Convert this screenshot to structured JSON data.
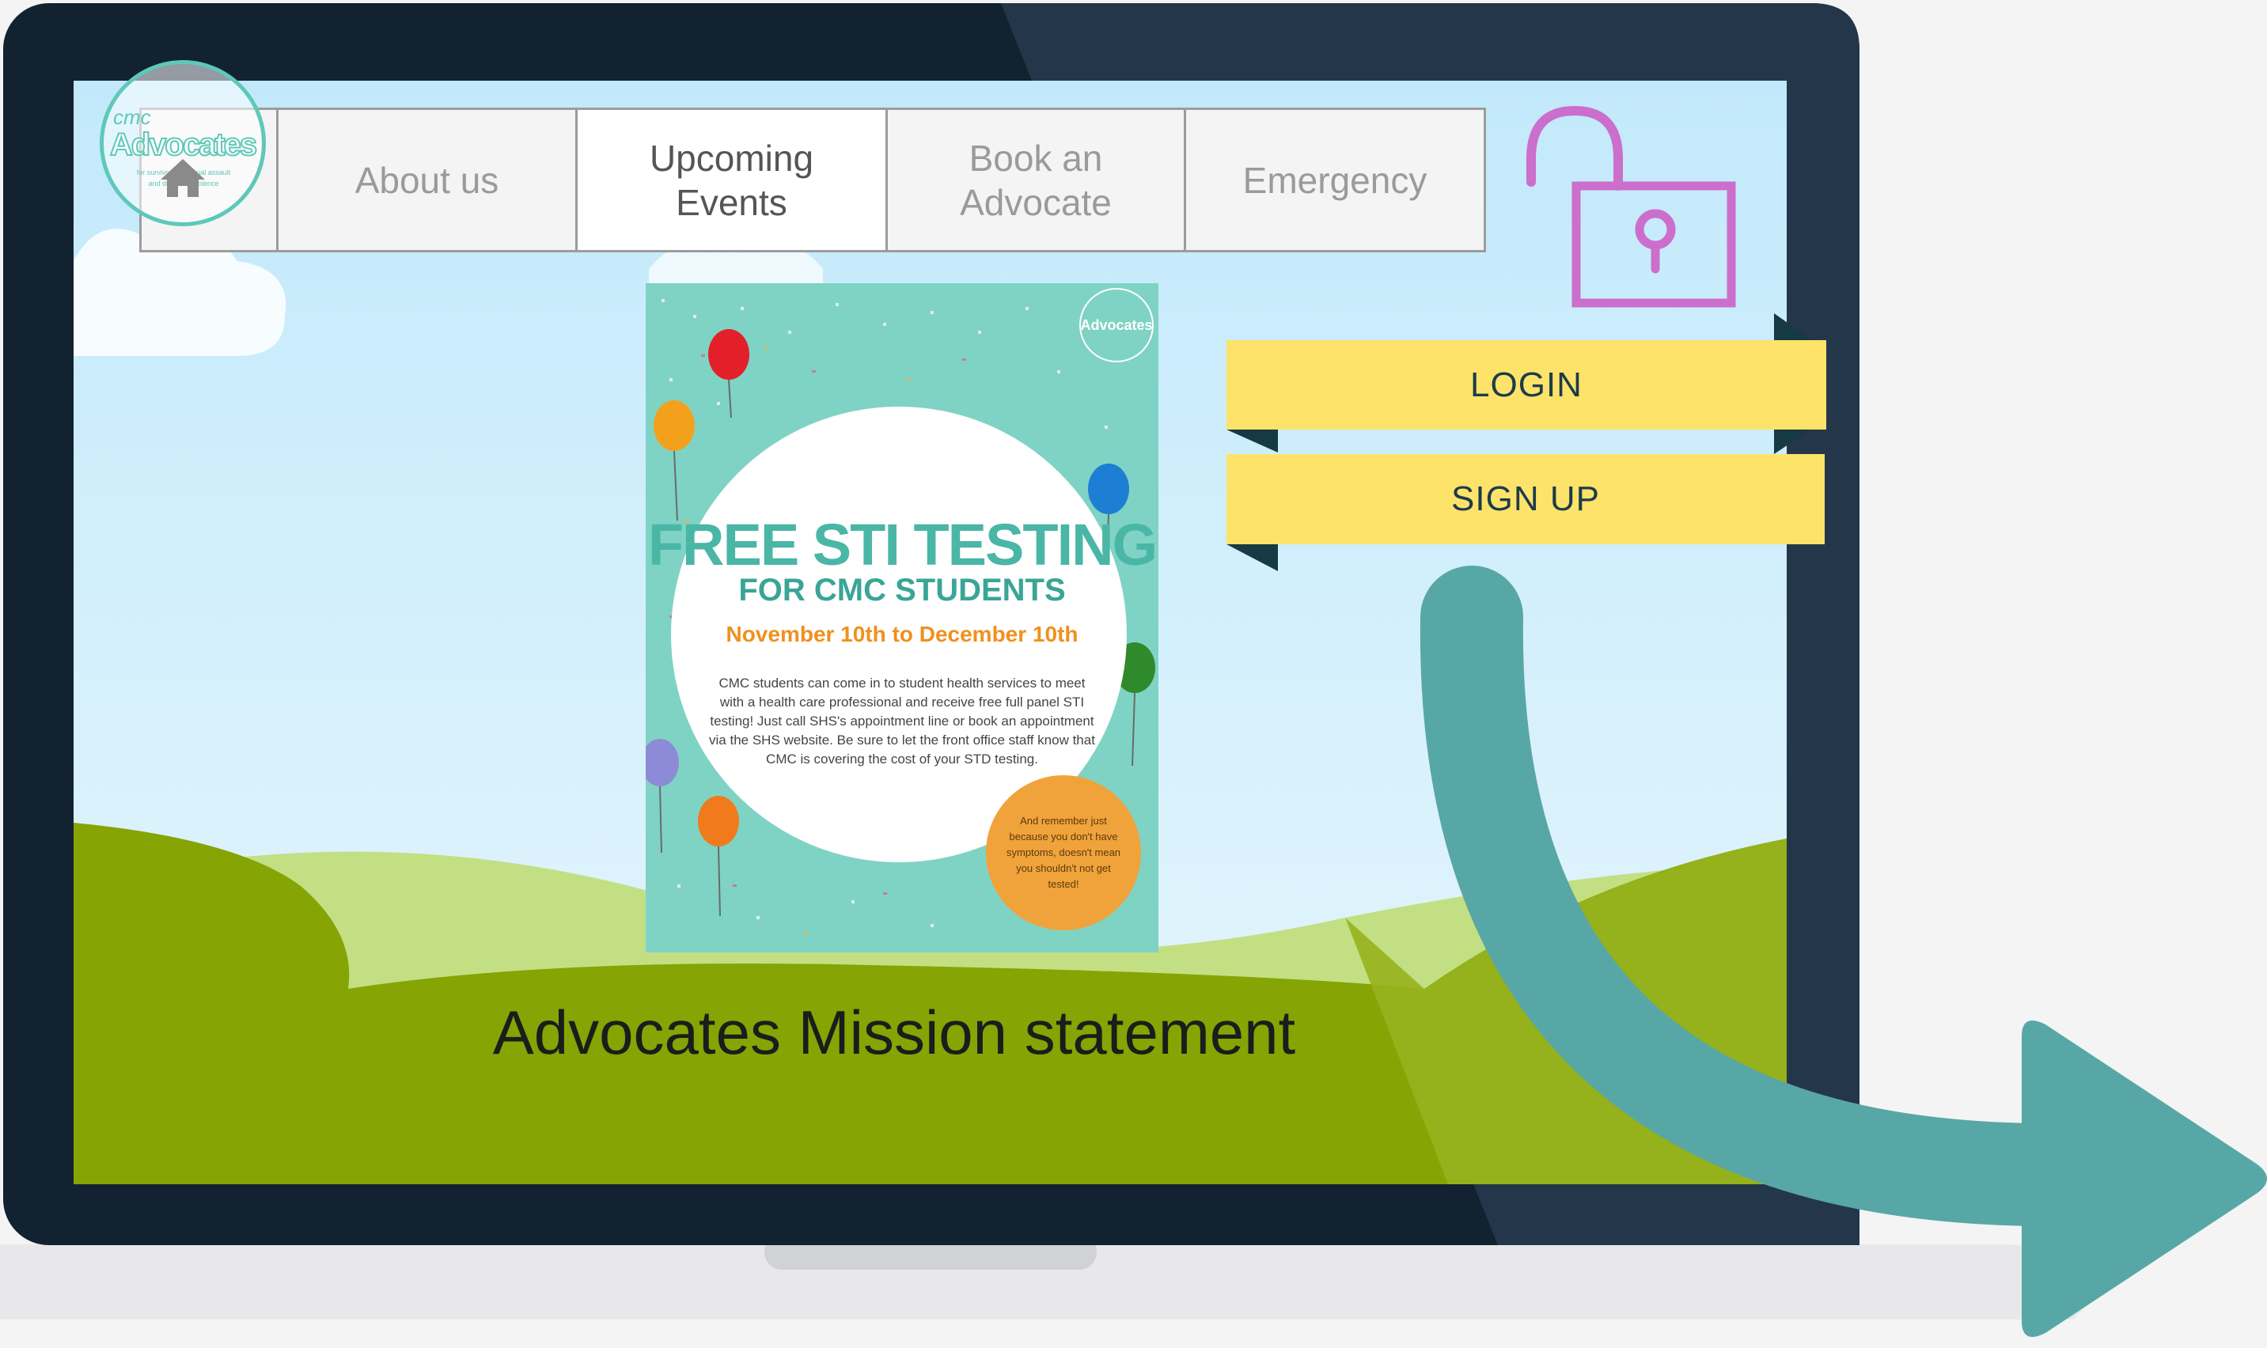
{
  "logo": {
    "small_text": "cmc",
    "name": "Advocates",
    "tagline_line1": "for survivors of sexual assault",
    "tagline_line2": "and domestic violence",
    "icon": "house-icon"
  },
  "nav": {
    "items": [
      {
        "label": "About us",
        "active": false
      },
      {
        "label": "Upcoming Events",
        "active": true
      },
      {
        "label": "Book an Advocate",
        "active": false
      },
      {
        "label": "Emergency",
        "active": false
      }
    ]
  },
  "lock": {
    "icon": "unlocked-padlock-icon",
    "color": "#cc6ecb"
  },
  "auth": {
    "login_label": "LOGIN",
    "signup_label": "SIGN UP"
  },
  "poster": {
    "logo_text": "Advocates",
    "title": "FREE STI TESTING",
    "subtitle": "FOR CMC STUDENTS",
    "dates": "November 10th to December 10th",
    "body": "CMC students can come in to student health services to meet with a health care professional and receive free full panel STI testing! Just call SHS's appointment line or book an appointment via the SHS website. Be sure to let the front office staff know that CMC is covering the cost of your STD testing.",
    "note": "And remember just because you don't have symptoms, doesn't mean you shouldn't not get tested!"
  },
  "mission": {
    "label": "Advocates Mission statement"
  },
  "arrow": {
    "icon": "curved-arrow-right-icon",
    "color": "#58a7a7"
  },
  "colors": {
    "laptop_frame": "#132231",
    "banner": "#fde36a",
    "hill_dark": "#86a403",
    "hill_light": "#c3df83",
    "sky": "#cdeefc"
  }
}
